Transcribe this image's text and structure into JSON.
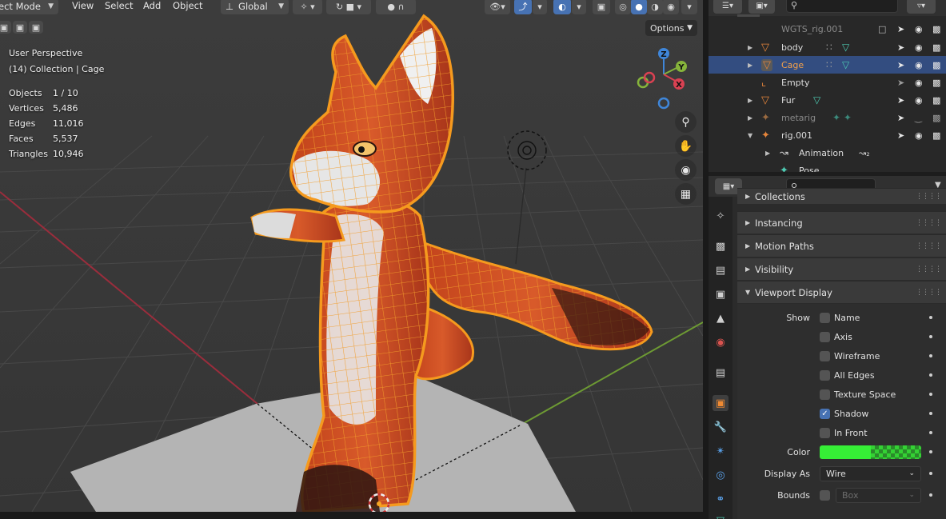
{
  "header": {
    "mode": "ect Mode",
    "menus": [
      "View",
      "Select",
      "Add",
      "Object"
    ],
    "orientation": "Global"
  },
  "viewport": {
    "perspective": "User Perspective",
    "collection": "(14) Collection | Cage",
    "stats": [
      {
        "key": "Objects",
        "value": "1 / 10"
      },
      {
        "key": "Vertices",
        "value": "5,486"
      },
      {
        "key": "Edges",
        "value": "11,016"
      },
      {
        "key": "Faces",
        "value": "5,537"
      },
      {
        "key": "Triangles",
        "value": "10,946"
      }
    ],
    "options_label": "Options",
    "gizmo": {
      "z": "Z",
      "y": "Y",
      "x": "X"
    }
  },
  "outliner": {
    "rows": [
      {
        "label": "WGTS_rig.001",
        "selected": false,
        "dim": true
      },
      {
        "label": "body",
        "selected": false,
        "dim": false
      },
      {
        "label": "Cage",
        "selected": true,
        "dim": false
      },
      {
        "label": "Empty",
        "selected": false,
        "dim": false
      },
      {
        "label": "Fur",
        "selected": false,
        "dim": false
      },
      {
        "label": "metarig",
        "selected": false,
        "dim": true
      },
      {
        "label": "rig.001",
        "selected": false,
        "dim": false
      },
      {
        "label": "Animation",
        "selected": false,
        "dim": false
      },
      {
        "label": "Pose",
        "selected": false,
        "dim": false
      }
    ]
  },
  "properties": {
    "sections": [
      {
        "label": "Collections",
        "expanded": false
      },
      {
        "label": "Instancing",
        "expanded": false
      },
      {
        "label": "Motion Paths",
        "expanded": false
      },
      {
        "label": "Visibility",
        "expanded": false
      },
      {
        "label": "Viewport Display",
        "expanded": true
      }
    ],
    "viewport_display": {
      "show_label": "Show",
      "checkboxes": [
        {
          "label": "Name",
          "checked": false
        },
        {
          "label": "Axis",
          "checked": false
        },
        {
          "label": "Wireframe",
          "checked": false
        },
        {
          "label": "All Edges",
          "checked": false
        },
        {
          "label": "Texture Space",
          "checked": false
        },
        {
          "label": "Shadow",
          "checked": true
        },
        {
          "label": "In Front",
          "checked": false
        }
      ],
      "color_label": "Color",
      "color_value": "#36ee36",
      "display_as_label": "Display As",
      "display_as_value": "Wire",
      "bounds_label": "Bounds",
      "bounds_value": "Box",
      "bounds_checked": false
    }
  },
  "colors": {
    "accent": "#4772b3",
    "selection_outline": "#f59a1e",
    "object_orange": "#e5853b",
    "x_axis": "#c8334a",
    "y_axis": "#7fb33a"
  }
}
